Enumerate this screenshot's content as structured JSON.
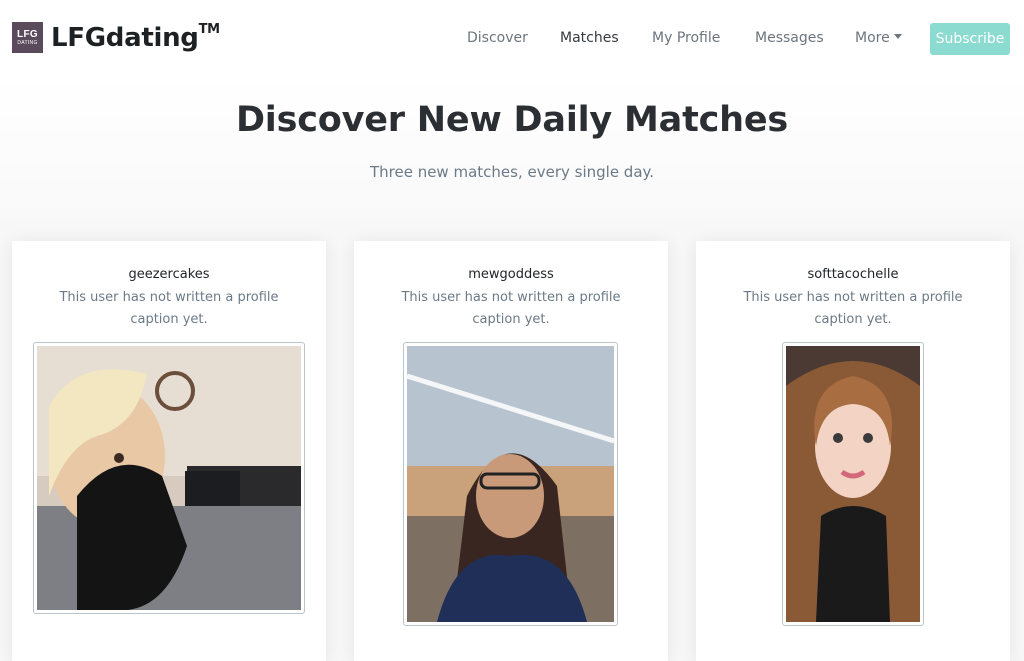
{
  "navbar": {
    "logo_line1": "LFG",
    "logo_line2": "DATING",
    "brand_name": "LFGdating",
    "brand_tm": "TM",
    "items": [
      {
        "label": "Discover"
      },
      {
        "label": "Matches"
      },
      {
        "label": "My Profile"
      },
      {
        "label": "Messages"
      },
      {
        "label": "More"
      }
    ],
    "subscribe_label": "Subscribe"
  },
  "hero": {
    "title": "Discover New Daily Matches",
    "subtitle": "Three new matches, every single day."
  },
  "matches": [
    {
      "username": "geezercakes",
      "caption": "This user has not written a profile caption yet."
    },
    {
      "username": "mewgoddess",
      "caption": "This user has not written a profile caption yet."
    },
    {
      "username": "softtacochelle",
      "caption": "This user has not written a profile caption yet."
    }
  ],
  "colors": {
    "accent": "#8bdbd1",
    "logo_bg": "#5a4a5c",
    "muted_text": "#6c7a87"
  }
}
